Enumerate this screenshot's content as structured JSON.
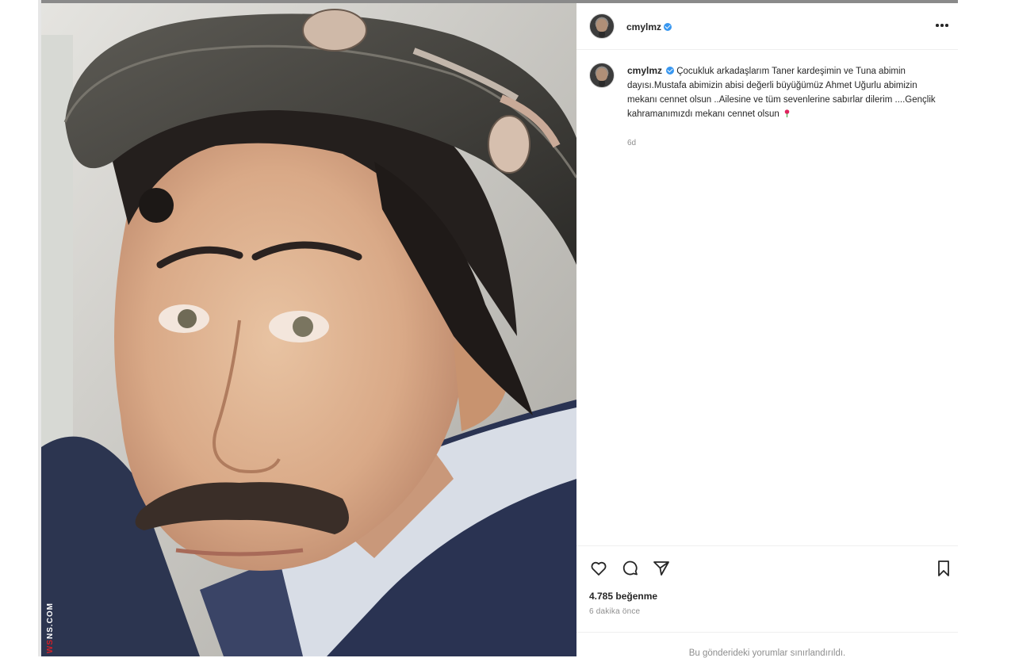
{
  "post": {
    "image_alt": "Kostümlü bir aktörün portresi",
    "watermark_red": "WS",
    "watermark_white": "NS.COM"
  },
  "header": {
    "username": "cmylmz",
    "verified": true,
    "more_icon": "more-horizontal-icon"
  },
  "caption": {
    "username": "cmylmz",
    "text": "Çocukluk arkadaşlarım Taner kardeşimin ve Tuna abimin dayısı.Mustafa abimizin abisi değerli büyüğümüz Ahmet Uğurlu abimizin mekanı cennet olsun ..Ailesine ve tüm sevenlerine sabırlar dilerim ....Gençlik kahramanımızdı mekanı cennet olsun",
    "emoji": "rose-icon",
    "time": "6d"
  },
  "actions": {
    "icons": [
      "heart-icon",
      "comment-icon",
      "share-icon",
      "bookmark-icon"
    ],
    "likes": "4.785 beğenme",
    "time_ago": "6 dakika önce",
    "comments_limited": "Bu gönderideki yorumlar sınırlandırıldı."
  },
  "colors": {
    "verified": "#3897f0",
    "meta_text": "#8e8e8e",
    "divider": "#efefef"
  }
}
